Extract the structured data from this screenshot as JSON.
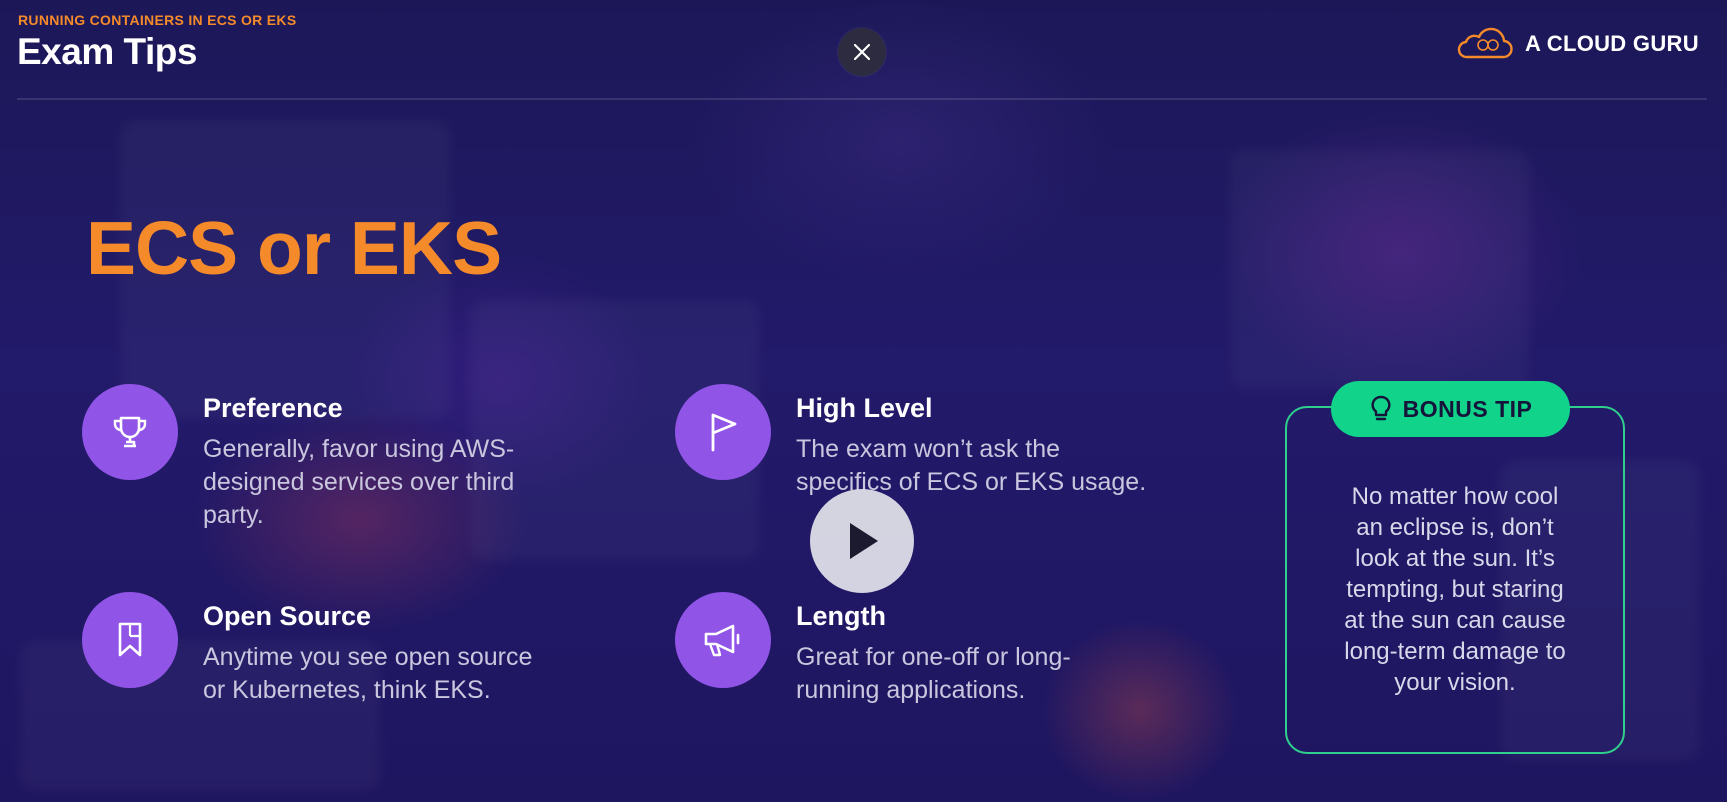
{
  "header": {
    "kicker": "RUNNING CONTAINERS IN ECS OR EKS",
    "title": "Exam Tips"
  },
  "brand": {
    "name": "A CLOUD GURU",
    "icon": "cloud-logo-icon"
  },
  "controls": {
    "close_icon": "close-icon",
    "play_icon": "play-icon"
  },
  "main": {
    "title": "ECS or EKS",
    "tips": [
      {
        "icon": "trophy-icon",
        "title": "Preference",
        "lines": [
          "Generally, favor using AWS-",
          "designed services over third",
          "party."
        ]
      },
      {
        "icon": "flag-icon",
        "title": "High Level",
        "lines": [
          "The exam won’t ask the",
          "specifics of ECS or EKS usage."
        ]
      },
      {
        "icon": "bookmark-icon",
        "title": "Open Source",
        "lines": [
          "Anytime you see open source",
          "or Kubernetes, think EKS."
        ]
      },
      {
        "icon": "megaphone-icon",
        "title": "Length",
        "lines": [
          "Great for one-off or long-",
          "running applications."
        ]
      }
    ]
  },
  "bonus": {
    "label": "BONUS TIP",
    "icon": "lightbulb-icon",
    "lines": [
      "No matter how cool",
      "an eclipse is, don’t",
      "look at the sun. It’s",
      "tempting, but staring",
      "at the sun can cause",
      "long-term damage to",
      "your vision."
    ]
  },
  "colors": {
    "accent": "#f58a2b",
    "icon_circle": "#9054e6",
    "bonus_green": "#12d38a",
    "background": "#221a6a"
  }
}
